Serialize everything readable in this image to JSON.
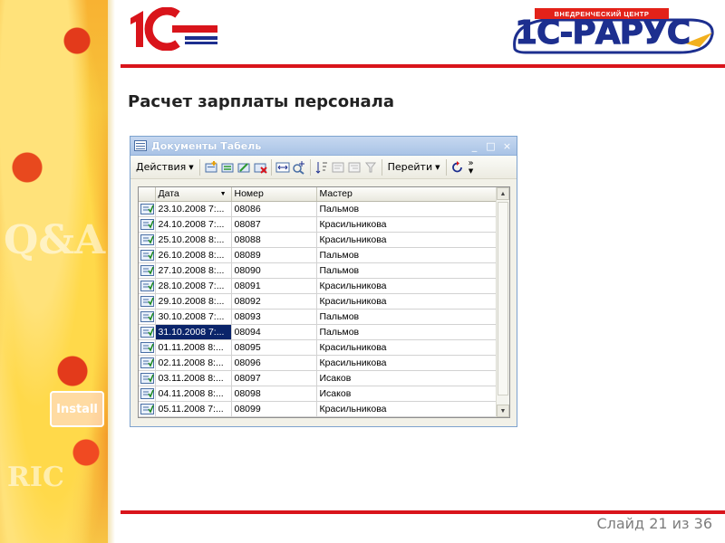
{
  "slide": {
    "title": "Расчет зарплаты персонала",
    "slide_number": "Слайд 21 из 36",
    "accent_color": "#d9141b"
  },
  "logos": {
    "left_logo_text": "1С",
    "right_logo_tagline": "ВНЕДРЕНЧЕСКИЙ ЦЕНТР",
    "right_logo_text": "1С-РАРУС"
  },
  "decor": {
    "install_label": "Install"
  },
  "window": {
    "title": "Документы Табель",
    "controls": [
      "_",
      "□",
      "×"
    ]
  },
  "toolbar": {
    "actions_label": "Действия",
    "goto_label": "Перейти",
    "more_label": "»"
  },
  "table": {
    "columns": [
      "Дата",
      "Номер",
      "Мастер"
    ],
    "selected_row_index": 8,
    "rows": [
      {
        "date": "23.10.2008 7:...",
        "number": "08086",
        "master": "Пальмов"
      },
      {
        "date": "24.10.2008 7:...",
        "number": "08087",
        "master": "Красильникова"
      },
      {
        "date": "25.10.2008 8:...",
        "number": "08088",
        "master": "Красильникова"
      },
      {
        "date": "26.10.2008 8:...",
        "number": "08089",
        "master": "Пальмов"
      },
      {
        "date": "27.10.2008 8:...",
        "number": "08090",
        "master": "Пальмов"
      },
      {
        "date": "28.10.2008 7:...",
        "number": "08091",
        "master": "Красильникова"
      },
      {
        "date": "29.10.2008 8:...",
        "number": "08092",
        "master": "Красильникова"
      },
      {
        "date": "30.10.2008 7:...",
        "number": "08093",
        "master": "Пальмов"
      },
      {
        "date": "31.10.2008 7:...",
        "number": "08094",
        "master": "Пальмов"
      },
      {
        "date": "01.11.2008 8:...",
        "number": "08095",
        "master": "Красильникова"
      },
      {
        "date": "02.11.2008 8:...",
        "number": "08096",
        "master": "Красильникова"
      },
      {
        "date": "03.11.2008 8:...",
        "number": "08097",
        "master": "Исаков"
      },
      {
        "date": "04.11.2008 8:...",
        "number": "08098",
        "master": "Исаков"
      },
      {
        "date": "05.11.2008 7:...",
        "number": "08099",
        "master": "Красильникова"
      }
    ]
  }
}
